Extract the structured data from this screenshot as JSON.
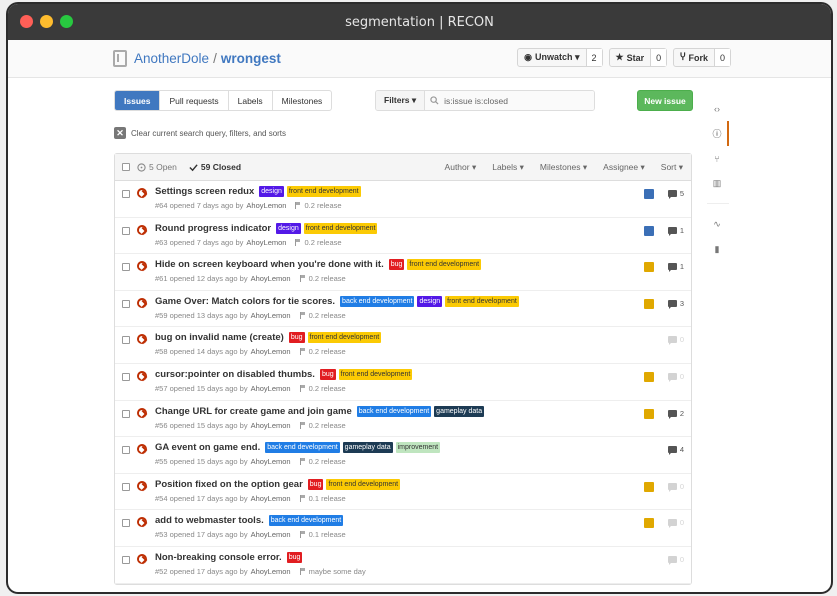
{
  "window": {
    "title": "segmentation | RECON"
  },
  "repo": {
    "owner": "AnotherDole",
    "separator": "/",
    "name": "wrongest"
  },
  "actions": [
    {
      "label": "Unwatch ▾",
      "count": "2",
      "icon": "eye-icon"
    },
    {
      "label": "Star",
      "count": "0",
      "icon": "star-icon"
    },
    {
      "label": "Fork",
      "count": "0",
      "icon": "fork-icon"
    }
  ],
  "tabs": [
    "Issues",
    "Pull requests",
    "Labels",
    "Milestones"
  ],
  "filters": {
    "button": "Filters ▾",
    "query": "is:issue is:closed"
  },
  "new_issue": "New issue",
  "clear_text": "Clear current search query, filters, and sorts",
  "states": {
    "open": "5 Open",
    "closed": "59 Closed"
  },
  "sorts": [
    "Author ▾",
    "Labels ▾",
    "Milestones ▾",
    "Assignee ▾",
    "Sort ▾"
  ],
  "label_colors": {
    "design": "#5319e7",
    "front end development": "#fbca04",
    "bug": "#e11d21",
    "back end development": "#207de5",
    "gameplay data": "#1d3b54",
    "improvement": "#bfe5bf"
  },
  "issues": [
    {
      "title": "Settings screen redux",
      "labels": [
        "design",
        "front end development"
      ],
      "meta": "#64 opened 7 days ago by",
      "author": "AhoyLemon",
      "milestone": "0.2 release",
      "comments": "5",
      "avatar": "blue"
    },
    {
      "title": "Round progress indicator",
      "labels": [
        "design",
        "front end development"
      ],
      "meta": "#63 opened 7 days ago by",
      "author": "AhoyLemon",
      "milestone": "0.2 release",
      "comments": "1",
      "avatar": "blue"
    },
    {
      "title": "Hide on screen keyboard when you're done with it.",
      "labels": [
        "bug",
        "front end development"
      ],
      "meta": "#61 opened 12 days ago by",
      "author": "AhoyLemon",
      "milestone": "0.2 release",
      "comments": "1",
      "avatar": "yellow"
    },
    {
      "title": "Game Over: Match colors for tie scores.",
      "labels": [
        "back end development",
        "design",
        "front end development"
      ],
      "meta": "#59 opened 13 days ago by",
      "author": "AhoyLemon",
      "milestone": "0.2 release",
      "comments": "3",
      "avatar": "yellow"
    },
    {
      "title": "bug on invalid name (create)",
      "labels": [
        "bug",
        "front end development"
      ],
      "meta": "#58 opened 14 days ago by",
      "author": "AhoyLemon",
      "milestone": "0.2 release",
      "comments": "0",
      "avatar": ""
    },
    {
      "title": "cursor:pointer on disabled thumbs.",
      "labels": [
        "bug",
        "front end development"
      ],
      "meta": "#57 opened 15 days ago by",
      "author": "AhoyLemon",
      "milestone": "0.2 release",
      "comments": "0",
      "avatar": "yellow"
    },
    {
      "title": "Change URL for create game and join game",
      "labels": [
        "back end development",
        "gameplay data"
      ],
      "meta": "#56 opened 15 days ago by",
      "author": "AhoyLemon",
      "milestone": "0.2 release",
      "comments": "2",
      "avatar": "yellow"
    },
    {
      "title": "GA event on game end.",
      "labels": [
        "back end development",
        "gameplay data",
        "improvement"
      ],
      "meta": "#55 opened 15 days ago by",
      "author": "AhoyLemon",
      "milestone": "0.2 release",
      "comments": "4",
      "avatar": ""
    },
    {
      "title": "Position fixed on the option gear",
      "labels": [
        "bug",
        "front end development"
      ],
      "meta": "#54 opened 17 days ago by",
      "author": "AhoyLemon",
      "milestone": "0.1 release",
      "comments": "0",
      "avatar": "yellow"
    },
    {
      "title": "add to webmaster tools.",
      "labels": [
        "back end development"
      ],
      "meta": "#53 opened 17 days ago by",
      "author": "AhoyLemon",
      "milestone": "0.1 release",
      "comments": "0",
      "avatar": "yellow"
    },
    {
      "title": "Non-breaking console error.",
      "labels": [
        "bug"
      ],
      "meta": "#52 opened 17 days ago by",
      "author": "AhoyLemon",
      "milestone": "maybe some day",
      "comments": "0",
      "avatar": ""
    }
  ],
  "sidenav": [
    "code-icon",
    "issues-icon",
    "pull-request-icon",
    "wiki-icon",
    "pulse-icon",
    "graphs-icon"
  ]
}
